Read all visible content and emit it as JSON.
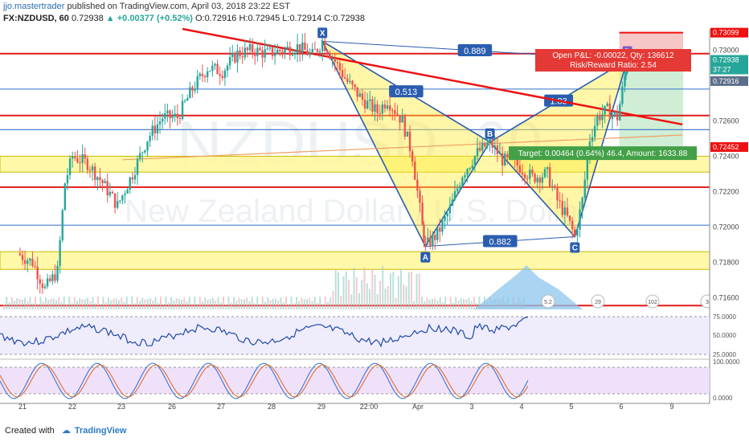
{
  "header": {
    "author": "jjo.mastertrader",
    "published": "published on TradingView.com, April 03, 2018 23:22 EST"
  },
  "symbol_line": {
    "symbol": "FX:NZDUSD, 60",
    "last": "0.72938",
    "change": "▲ +0.00377 (+0.52%)",
    "open": "O:0.72916",
    "high": "H:0.72945",
    "low": "L:0.72914",
    "close": "C:0.72938"
  },
  "watermark": {
    "ticker": "NZDUSD, 60",
    "name": "New Zealand Dollar / U.S. Dollar"
  },
  "footer": {
    "created_with": "Created with",
    "brand": "TradingView"
  },
  "pattern": {
    "points": [
      {
        "label": "X",
        "x": 27.0,
        "price": 0.7305
      },
      {
        "label": "A",
        "x": 29.06,
        "price": 0.7189
      },
      {
        "label": "B",
        "x": 30.35,
        "price": 0.7248
      },
      {
        "label": "C",
        "x": 32.05,
        "price": 0.71945
      },
      {
        "label": "D",
        "x": 33.1,
        "price": 0.72945
      }
    ],
    "ratios": [
      {
        "from": "X",
        "to": "D",
        "label": "0.889"
      },
      {
        "from": "X",
        "to": "B",
        "label": "0.513"
      },
      {
        "from": "A",
        "to": "C",
        "label": "0.882"
      },
      {
        "from": "B",
        "to": "D",
        "label": "1.83"
      }
    ]
  },
  "position": {
    "open_pnl": "Open P&L: -0.00022, Qty: 136612",
    "risk_reward": "Risk/Reward Ratio: 2.54",
    "target": "Target: 0.00464 (0.64%) 46.4, Amount: 1633.88",
    "stop_price": 0.73099,
    "entry_price": 0.72916,
    "target_price": 0.72452
  },
  "price_axis": {
    "ticks": [
      "0.73000",
      "0.72600",
      "0.72400",
      "0.72200",
      "0.72000",
      "0.71800",
      "0.71600"
    ],
    "labels": {
      "stop": "0.73099",
      "last": "0.72938",
      "countdown": "37:27",
      "entry": "0.72916",
      "target": "0.72452"
    }
  },
  "time_axis": {
    "labels": [
      "21",
      "22",
      "23",
      "26",
      "27",
      "28",
      "29",
      "22:00",
      "Apr",
      "3",
      "4",
      "5",
      "6",
      "9"
    ]
  },
  "rsi": {
    "ticks": [
      "75.0000",
      "50.0000",
      "25.0000"
    ]
  },
  "stoch": {
    "ticks": [
      "100.0000",
      "0.0000"
    ]
  },
  "events": [
    "5.2",
    "29",
    "102",
    "3"
  ],
  "chart_data": {
    "type": "candlestick",
    "title": "FX:NZDUSD, 60",
    "x_axis": [
      "21",
      "22",
      "23",
      "26",
      "27",
      "28",
      "29",
      "22:00",
      "Apr",
      "3",
      "4",
      "5",
      "6",
      "9"
    ],
    "ylim": [
      0.7152,
      0.7312
    ],
    "trend_lines": [
      {
        "name": "red descending",
        "points": [
          [
            24.2,
            0.7312
          ],
          [
            34.2,
            0.7258
          ]
        ]
      },
      {
        "name": "orange ascending",
        "points": [
          [
            23.0,
            0.7238
          ],
          [
            34.2,
            0.7252
          ]
        ]
      }
    ],
    "horizontal_levels": [
      {
        "price": 0.7298,
        "color": "red"
      },
      {
        "price": 0.7278,
        "color": "blue"
      },
      {
        "price": 0.7263,
        "color": "red"
      },
      {
        "price": 0.7255,
        "color": "blue"
      },
      {
        "price": 0.72225,
        "color": "red"
      },
      {
        "price": 0.7201,
        "color": "blue"
      },
      {
        "price": 0.71555,
        "color": "red"
      }
    ],
    "zones": [
      {
        "from": 0.7231,
        "to": 0.724,
        "color": "yellow"
      },
      {
        "from": 0.7176,
        "to": 0.7186,
        "color": "yellow"
      }
    ],
    "price_path": [
      [
        20.9,
        0.7185
      ],
      [
        21.2,
        0.718
      ],
      [
        21.45,
        0.7165
      ],
      [
        21.7,
        0.7175
      ],
      [
        21.85,
        0.7225
      ],
      [
        22.0,
        0.724
      ],
      [
        22.3,
        0.7236
      ],
      [
        22.6,
        0.7225
      ],
      [
        22.9,
        0.7212
      ],
      [
        23.2,
        0.723
      ],
      [
        23.5,
        0.725
      ],
      [
        23.8,
        0.7262
      ],
      [
        24.1,
        0.7262
      ],
      [
        24.4,
        0.7278
      ],
      [
        24.7,
        0.729
      ],
      [
        25.0,
        0.7288
      ],
      [
        25.3,
        0.7298
      ],
      [
        25.6,
        0.73
      ],
      [
        25.9,
        0.7298
      ],
      [
        26.2,
        0.73
      ],
      [
        26.5,
        0.7302
      ],
      [
        26.8,
        0.7297
      ],
      [
        27.0,
        0.7305
      ],
      [
        27.2,
        0.7296
      ],
      [
        27.5,
        0.7282
      ],
      [
        27.8,
        0.7272
      ],
      [
        28.1,
        0.7265
      ],
      [
        28.3,
        0.7272
      ],
      [
        28.6,
        0.726
      ],
      [
        28.8,
        0.724
      ],
      [
        29.0,
        0.72
      ],
      [
        29.06,
        0.7189
      ],
      [
        29.3,
        0.7196
      ],
      [
        29.55,
        0.721
      ],
      [
        29.8,
        0.723
      ],
      [
        30.1,
        0.7242
      ],
      [
        30.35,
        0.7248
      ],
      [
        30.6,
        0.7238
      ],
      [
        30.9,
        0.7235
      ],
      [
        31.2,
        0.7228
      ],
      [
        31.5,
        0.723
      ],
      [
        31.7,
        0.7215
      ],
      [
        31.9,
        0.7205
      ],
      [
        32.05,
        0.71945
      ],
      [
        32.2,
        0.7215
      ],
      [
        32.35,
        0.725
      ],
      [
        32.5,
        0.7262
      ],
      [
        32.7,
        0.7266
      ],
      [
        32.9,
        0.7262
      ],
      [
        33.05,
        0.7285
      ],
      [
        33.1,
        0.72938
      ]
    ],
    "rsi_ylim": [
      20,
      80
    ],
    "rsi_levels": [
      70,
      30
    ],
    "stoch_levels": [
      80,
      20
    ],
    "volume_profile_peak_x": 31.0
  }
}
